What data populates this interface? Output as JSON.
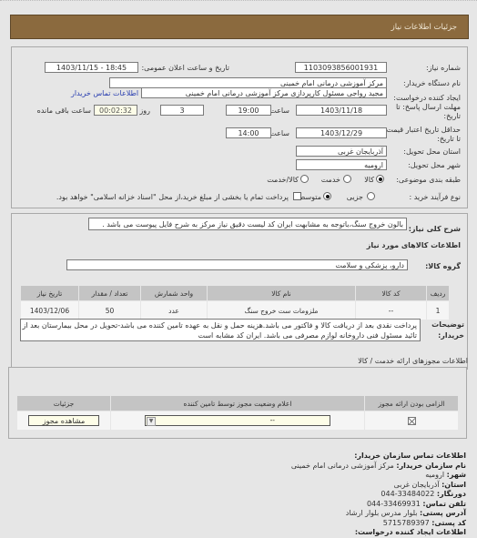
{
  "header": {
    "title": "جزئیات اطلاعات نیاز"
  },
  "form": {
    "need_number_label": "شماره نیاز:",
    "need_number": "1103093856001931",
    "announce_label": "تاریخ و ساعت اعلان عمومی:",
    "announce_value": "1403/11/15 - 18:45",
    "buyer_org_label": "نام دستگاه خریدار:",
    "buyer_org": "مرکز آموزشی درمانی امام خمینی",
    "creator_label": "ایجاد کننده درخواست:",
    "creator": "مجید  رواجی مسئول کارپردازی مرکز آموزشی درمانی امام خمینی",
    "buyer_contact_link": "اطلاعات تماس خریدار",
    "deadline_label": "مهلت ارسال پاسخ: تا تاریخ:",
    "deadline_date": "1403/11/18",
    "time_label": "ساعت",
    "deadline_time": "19:00",
    "days_value": "3",
    "days_label": "روز و",
    "remaining_time": "00:02:32",
    "remaining_label": "ساعت باقی مانده",
    "validity_label": "حداقل تاریخ اعتبار قیمت: تا تاریخ:",
    "validity_date": "1403/12/29",
    "validity_time": "14:00",
    "province_label": "استان محل تحویل:",
    "province": "آذربایجان غربی",
    "city_label": "شهر محل تحویل:",
    "city": "ارومیه",
    "category_label": "طبقه بندی موضوعی:",
    "category_options": [
      {
        "label": "کالا",
        "selected": true
      },
      {
        "label": "خدمت",
        "selected": false
      },
      {
        "label": "کالا/خدمت",
        "selected": false
      }
    ],
    "process_label": "نوع فرآیند خرید :",
    "process_options": [
      {
        "label": "جزیی",
        "selected": false
      },
      {
        "label": "متوسط",
        "selected": true
      }
    ],
    "treasury_checkbox_checked": false,
    "treasury_text": "پرداخت تمام یا بخشی از مبلغ خرید،از محل \"اسناد خزانه اسلامی\" خواهد بود."
  },
  "summary": {
    "label": "شرح کلی نیاز:",
    "value": "بالون خروج سنگ،باتوجه به مشابهت ایران کد لیست دقیق نیاز مرکز به شرح فایل پیوست می باشد ."
  },
  "goods_section": {
    "title": "اطلاعات کالاهای مورد نیاز",
    "group_label": "گروه کالا:",
    "group_value": "دارو، پزشکی و سلامت",
    "columns": [
      "ردیف",
      "کد کالا",
      "نام کالا",
      "واحد شمارش",
      "تعداد / مقدار",
      "تاریخ نیاز"
    ],
    "rows": [
      [
        "1",
        "--",
        "ملزومات ست خروج سنگ",
        "عدد",
        "50",
        "1403/12/06"
      ]
    ],
    "buyer_notes_label": "توضیحات خریدار:",
    "buyer_notes": "پرداخت نقدی بعد از دریافت کالا و فاکتور می باشد.هزینه حمل و نقل به عهده تامین کننده می باشد-تحویل در محل بیمارستان بعد از تائید مسئول فنی داروخانه لوازم مصرفی می باشد. ایران کد مشابه است"
  },
  "permits": {
    "title": "اطلاعات مجوزهای ارائه خدمت / کالا",
    "columns": [
      "الزامی بودن ارائه مجوز",
      "اعلام وضعیت مجوز توسط تامین کننده",
      "جزئیات"
    ],
    "row": {
      "required_checked": true,
      "status_value": "--",
      "view_button": "مشاهده مجوز"
    }
  },
  "contact": {
    "title": "اطلاعات تماس سازمان خریدار:",
    "org_label": "نام سازمان خریدار:",
    "org": "مرکز آموزشی درمانی امام خمینی",
    "city_label": "شهر:",
    "city": "ارومیه",
    "province_label": "استان:",
    "province": "آذربایجان غربی",
    "fax_label": "دورنگار:",
    "fax": "044-33484022",
    "phone_label": "تلفن تماس:",
    "phone": "044-33469931",
    "address_label": "آدرس پستی:",
    "address": "بلوار مدرس بلوار ارشاد",
    "postal_label": "کد پستی:",
    "postal": "5715789397",
    "creator_title": "اطلاعات ایجاد کننده درخواست:"
  },
  "colors": {
    "header_bg": "#8b6a3e",
    "link": "#2a3fb0",
    "table_header": "#c4c4c4"
  }
}
